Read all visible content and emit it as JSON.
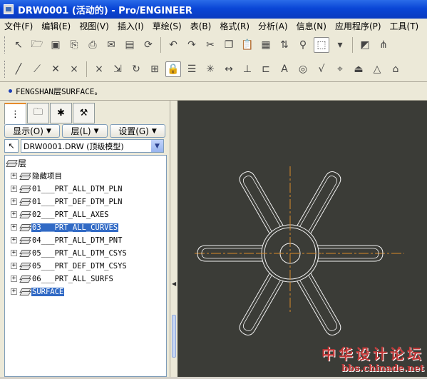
{
  "window": {
    "title": "DRW0001 (活动的) - Pro/ENGINEER"
  },
  "menu": [
    "文件(F)",
    "编辑(E)",
    "视图(V)",
    "插入(I)",
    "草绘(S)",
    "表(B)",
    "格式(R)",
    "分析(A)",
    "信息(N)",
    "应用程序(P)",
    "工具(T)"
  ],
  "message": {
    "text": "FENGSHAN层SURFACE。"
  },
  "panel": {
    "tabs": [
      "model-tree-tab",
      "folder-tab",
      "favorites-tab",
      "layer-tab"
    ],
    "dropdowns": {
      "show": "显示(O)",
      "layer": "层(L)",
      "settings": "设置(G)"
    },
    "model_selector": "DRW0001.DRW (顶级模型)",
    "tree_root": "层",
    "layers": [
      {
        "label": "隐藏项目",
        "selected": false
      },
      {
        "label": "01___PRT_ALL_DTM_PLN",
        "selected": false
      },
      {
        "label": "01___PRT_DEF_DTM_PLN",
        "selected": false
      },
      {
        "label": "02___PRT_ALL_AXES",
        "selected": false
      },
      {
        "label": "03___PRT_ALL_CURVES",
        "selected": true
      },
      {
        "label": "04___PRT_ALL_DTM_PNT",
        "selected": false
      },
      {
        "label": "05___PRT_ALL_DTM_CSYS",
        "selected": false
      },
      {
        "label": "05___PRT_DEF_DTM_CSYS",
        "selected": false
      },
      {
        "label": "06___PRT_ALL_SURFS",
        "selected": false
      },
      {
        "label": "SURFACE",
        "selected": true
      }
    ]
  },
  "watermark": {
    "title": "中华设计论坛",
    "url": "bbs.chinade.net"
  },
  "colors": {
    "canvas_bg": "#3b3c37",
    "centerline": "#d98a2a",
    "geometry": "#f2f2f2",
    "selection": "#316ac5"
  }
}
